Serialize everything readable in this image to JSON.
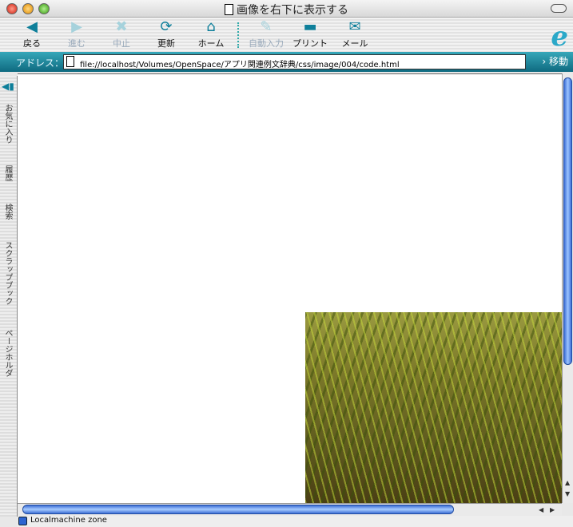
{
  "window": {
    "title": "画像を右下に表示する"
  },
  "toolbar": {
    "buttons": [
      {
        "label": "戻る",
        "icon": "back-arrow-icon",
        "enabled": true
      },
      {
        "label": "進む",
        "icon": "forward-arrow-icon",
        "enabled": false
      },
      {
        "label": "中止",
        "icon": "stop-icon",
        "enabled": false
      },
      {
        "label": "更新",
        "icon": "refresh-icon",
        "enabled": true
      },
      {
        "label": "ホーム",
        "icon": "home-icon",
        "enabled": true
      },
      {
        "label": "自動入力",
        "icon": "autofill-icon",
        "enabled": false
      },
      {
        "label": "プリント",
        "icon": "print-icon",
        "enabled": true
      },
      {
        "label": "メール",
        "icon": "mail-icon",
        "enabled": true
      }
    ]
  },
  "address": {
    "label": "アドレス：",
    "url": "file://localhost/Volumes/OpenSpace/アプリ関連例文辞典/css/image/004/code.html",
    "go": "移動"
  },
  "sidebar": {
    "tabs": [
      "お気に入り",
      "履歴",
      "検索",
      "スクラップブック",
      "ページホルダ"
    ]
  },
  "status": {
    "zone": "Localmachine zone"
  },
  "colors": {
    "accent": "#0e7f9a",
    "scroll": "#3c6ed6"
  }
}
